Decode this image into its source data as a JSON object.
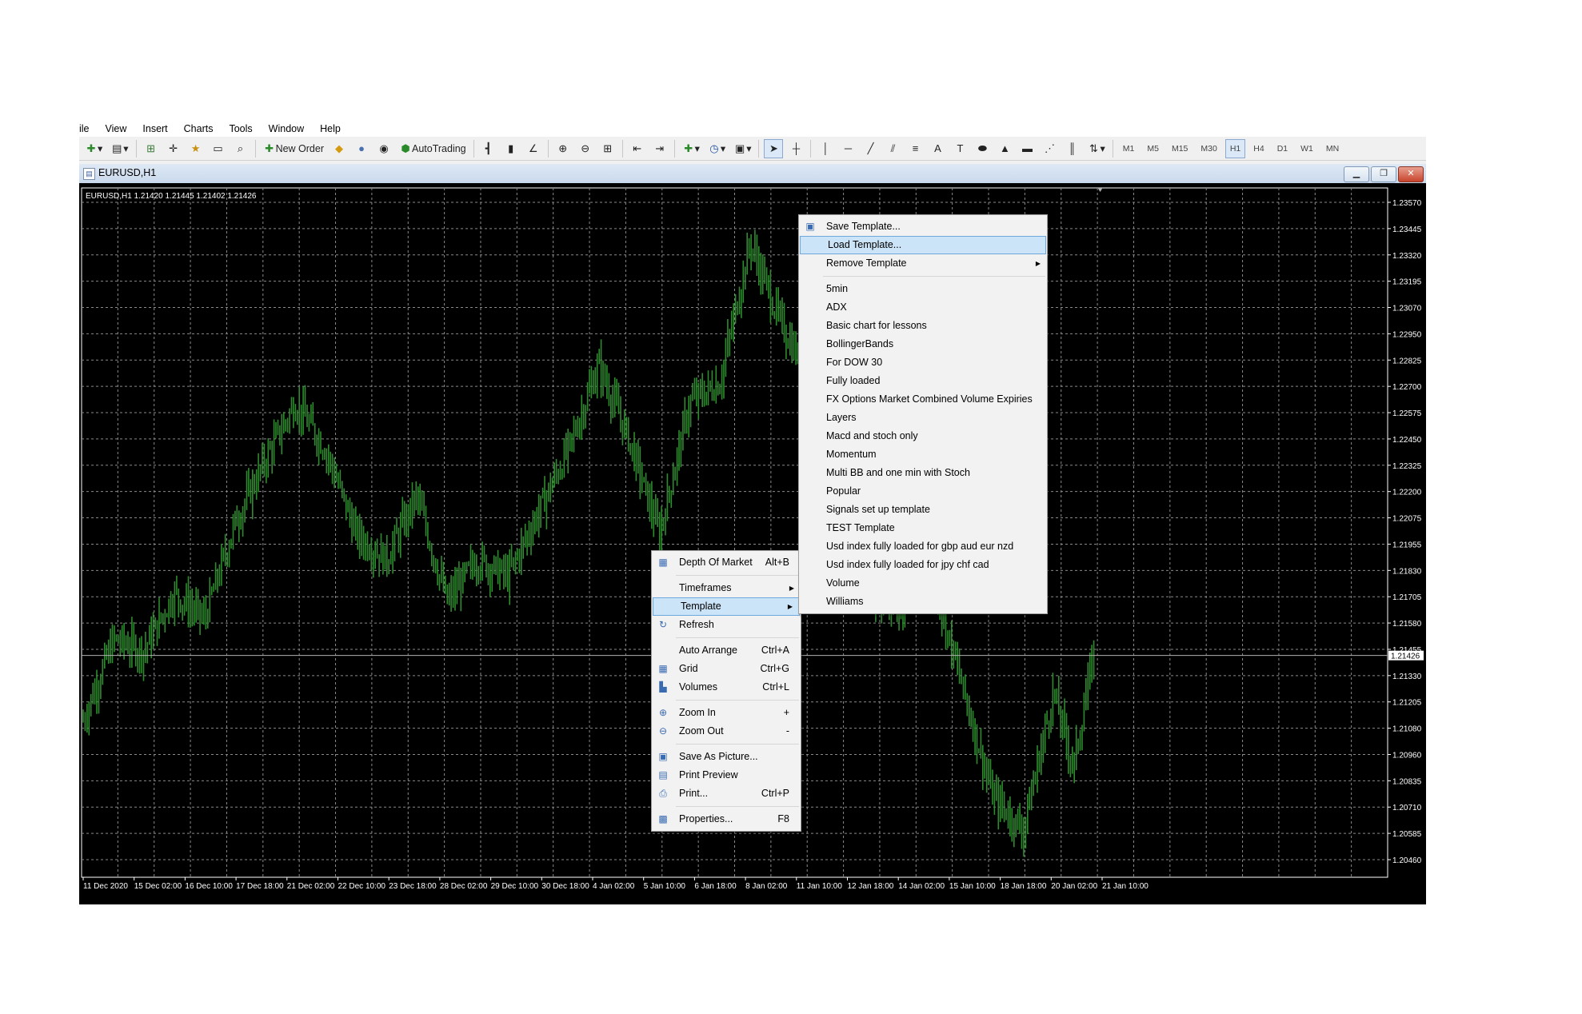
{
  "menu": [
    "ile",
    "View",
    "Insert",
    "Charts",
    "Tools",
    "Window",
    "Help"
  ],
  "toolbar": {
    "new_order": "New Order",
    "autotrading": "AutoTrading",
    "timeframes": [
      "M1",
      "M5",
      "M15",
      "M30",
      "H1",
      "H4",
      "D1",
      "W1",
      "MN"
    ],
    "active_timeframe": "H1"
  },
  "window": {
    "title": "EURUSD,H1"
  },
  "chart": {
    "info": "EURUSD,H1  1.21420 1.21445 1.21402 1.21426",
    "current_price": "1.21426",
    "price_color": "#2e8b2e"
  },
  "chart_data": {
    "type": "bar",
    "symbol": "EURUSD",
    "timeframe": "H1",
    "ohlc": {
      "open": 1.2142,
      "high": 1.21445,
      "low": 1.21402,
      "close": 1.21426
    },
    "y_ticks": [
      "1.23570",
      "1.23445",
      "1.23320",
      "1.23195",
      "1.23070",
      "1.22950",
      "1.22825",
      "1.22700",
      "1.22575",
      "1.22450",
      "1.22325",
      "1.22200",
      "1.22075",
      "1.21955",
      "1.21830",
      "1.21705",
      "1.21580",
      "1.21455",
      "1.21330",
      "1.21205",
      "1.21080",
      "1.20960",
      "1.20835",
      "1.20710",
      "1.20585",
      "1.20460"
    ],
    "x_ticks": [
      "11 Dec 2020",
      "15 Dec 02:00",
      "16 Dec 10:00",
      "17 Dec 18:00",
      "21 Dec 02:00",
      "22 Dec 10:00",
      "23 Dec 18:00",
      "28 Dec 02:00",
      "29 Dec 10:00",
      "30 Dec 18:00",
      "4 Jan 02:00",
      "5 Jan 10:00",
      "6 Jan 18:00",
      "8 Jan 02:00",
      "11 Jan 10:00",
      "12 Jan 18:00",
      "14 Jan 02:00",
      "15 Jan 10:00",
      "18 Jan 18:00",
      "20 Jan 02:00",
      "21 Jan 10:00"
    ],
    "ylim": [
      1.2046,
      1.2357
    ],
    "grid": true,
    "series_path": {
      "x": [
        0,
        3,
        6,
        9,
        12,
        15,
        18,
        21,
        24,
        27,
        30,
        33,
        36,
        39,
        42,
        45,
        48,
        51,
        54,
        57,
        60,
        63,
        66,
        69,
        72,
        75,
        78,
        81,
        84,
        87,
        90,
        93,
        96,
        98,
        100
      ],
      "y": [
        1.2112,
        1.215,
        1.2145,
        1.2172,
        1.216,
        1.2205,
        1.2235,
        1.2262,
        1.224,
        1.22,
        1.2188,
        1.2218,
        1.2168,
        1.2188,
        1.218,
        1.221,
        1.224,
        1.228,
        1.2245,
        1.22,
        1.2262,
        1.2272,
        1.2338,
        1.23,
        1.2272,
        1.2225,
        1.217,
        1.2165,
        1.218,
        1.2128,
        1.2076,
        1.206,
        1.2125,
        1.209,
        1.2144
      ]
    }
  },
  "context_menu": {
    "items": [
      {
        "label": "Depth Of Market",
        "shortcut": "Alt+B",
        "icon": "depth-of-market-icon",
        "glyph": "▦"
      },
      {
        "sep": true
      },
      {
        "label": "Timeframes",
        "submenu": true
      },
      {
        "label": "Template",
        "submenu": true,
        "highlight": true
      },
      {
        "label": "Refresh",
        "icon": "refresh-icon",
        "glyph": "↻"
      },
      {
        "sep": true
      },
      {
        "label": "Auto Arrange",
        "shortcut": "Ctrl+A"
      },
      {
        "label": "Grid",
        "shortcut": "Ctrl+G",
        "icon": "grid-icon",
        "glyph": "▦"
      },
      {
        "label": "Volumes",
        "shortcut": "Ctrl+L",
        "icon": "volumes-icon",
        "glyph": "▙"
      },
      {
        "sep": true
      },
      {
        "label": "Zoom In",
        "shortcut": "+",
        "icon": "zoom-in-icon",
        "glyph": "⊕"
      },
      {
        "label": "Zoom Out",
        "shortcut": "-",
        "icon": "zoom-out-icon",
        "glyph": "⊖"
      },
      {
        "sep": true
      },
      {
        "label": "Save As Picture...",
        "icon": "save-picture-icon",
        "glyph": "▣"
      },
      {
        "label": "Print Preview",
        "icon": "print-preview-icon",
        "glyph": "▤"
      },
      {
        "label": "Print...",
        "shortcut": "Ctrl+P",
        "icon": "print-icon",
        "glyph": "⎙"
      },
      {
        "sep": true
      },
      {
        "label": "Properties...",
        "shortcut": "F8",
        "icon": "properties-icon",
        "glyph": "▩"
      }
    ]
  },
  "template_menu": {
    "items": [
      {
        "label": "Save Template...",
        "icon": "save-template-icon",
        "glyph": "▣"
      },
      {
        "label": "Load Template...",
        "highlight": true
      },
      {
        "label": "Remove Template",
        "submenu": true
      },
      {
        "sep": true
      },
      {
        "label": "5min"
      },
      {
        "label": "ADX"
      },
      {
        "label": "Basic chart for lessons"
      },
      {
        "label": "BollingerBands"
      },
      {
        "label": "For DOW 30"
      },
      {
        "label": "Fully loaded"
      },
      {
        "label": "FX Options Market Combined Volume Expiries"
      },
      {
        "label": "Layers"
      },
      {
        "label": "Macd and stoch only"
      },
      {
        "label": "Momentum"
      },
      {
        "label": "Multi BB and one min with Stoch"
      },
      {
        "label": "Popular"
      },
      {
        "label": "Signals set up template"
      },
      {
        "label": "TEST Template"
      },
      {
        "label": "Usd index fully loaded for gbp aud eur nzd"
      },
      {
        "label": "Usd index fully loaded for jpy chf cad"
      },
      {
        "label": "Volume"
      },
      {
        "label": "Williams"
      }
    ]
  }
}
